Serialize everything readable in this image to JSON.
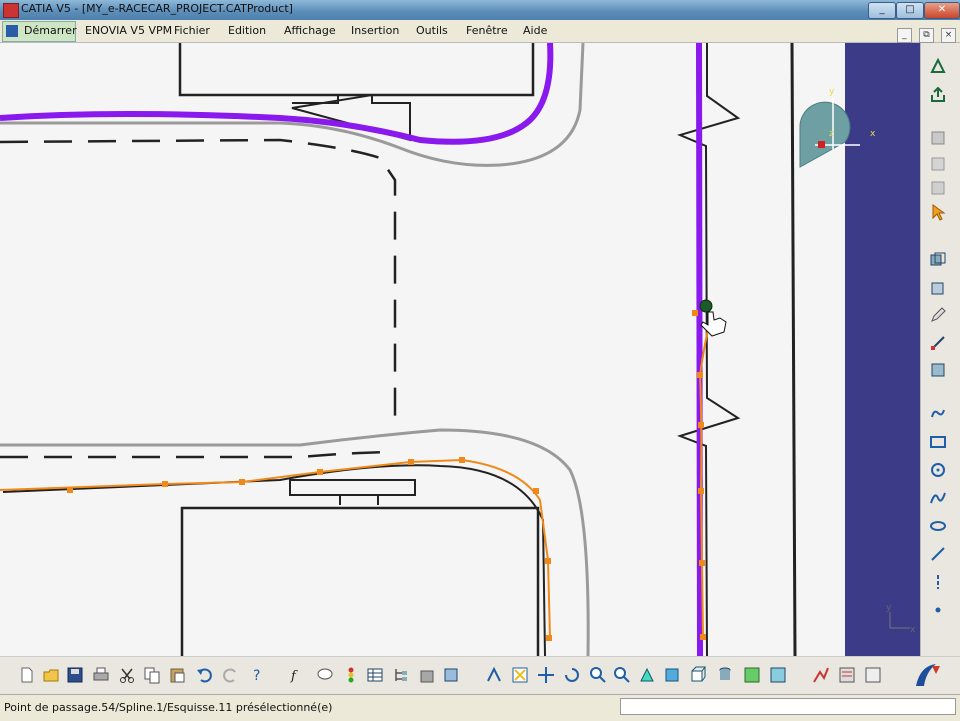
{
  "window": {
    "title": "CATIA V5 - [MY_e-RACECAR_PROJECT.CATProduct]",
    "controls": [
      "_",
      "□",
      "✕"
    ]
  },
  "menubar": {
    "start": "Démarrer",
    "items": [
      "ENOVIA V5 VPM",
      "Fichier",
      "Edition",
      "Affichage",
      "Insertion",
      "Outils",
      "Fenêtre",
      "Aide"
    ],
    "doc_controls": [
      "_",
      "⧉",
      "×"
    ]
  },
  "canvas": {
    "compass_labels": {
      "x": "x",
      "y": "y",
      "z": "z"
    },
    "axis_labels": {
      "x": "x",
      "y": "y"
    },
    "colors": {
      "background": "#f5f5f5",
      "purple_path": "#8a19ee",
      "orange_spline": "#ef8a1a",
      "outline": "#222222",
      "grey_road": "#9a9a9a"
    }
  },
  "right_toolbar": {
    "icons": [
      "fit-all-icon",
      "export-icon",
      "manipulate-icon",
      "properties-icon",
      "view-icon",
      "select-arrow-icon",
      "sketch-tools-icon",
      "cube-icon",
      "pencil-icon",
      "constraint-icon",
      "layers-icon",
      "profile-icon",
      "rectangle-icon",
      "circle-icon",
      "spline-icon",
      "ellipse-icon",
      "line-icon",
      "axis-icon",
      "point-icon"
    ]
  },
  "bottom_toolbar": {
    "icons": [
      "new-icon",
      "open-icon",
      "save-icon",
      "print-icon",
      "cut-icon",
      "copy-icon",
      "paste-icon",
      "undo-icon",
      "redo-icon",
      "help-icon",
      "formula-icon",
      "comment-icon",
      "lights-icon",
      "table-icon",
      "tree-icon",
      "bag-icon",
      "catalog-icon",
      "compass-icon",
      "fly-icon",
      "pan-icon",
      "rotate-icon",
      "zoom-in-icon",
      "zoom-out-icon",
      "normal-view-icon",
      "iso-view-icon",
      "render-icon",
      "hide-show-icon",
      "swap-icon",
      "layer-icon",
      "frame-icon",
      "measure-icon"
    ]
  },
  "statusbar": {
    "message": "Point de passage.54/Spline.1/Esquisse.11 présélectionné(e)",
    "command_value": ""
  }
}
